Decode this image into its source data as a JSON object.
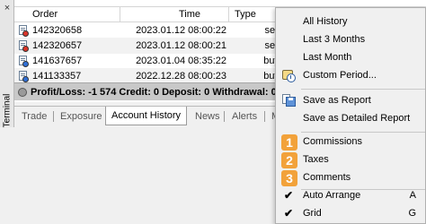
{
  "terminal": {
    "side_label": "Terminal",
    "close_glyph": "×",
    "columns": {
      "order": "Order",
      "time": "Time",
      "type": "Type"
    },
    "rows": [
      {
        "order": "142320658",
        "time": "2023.01.12 08:00:22",
        "type": "sell",
        "icon": "order-sell-icon"
      },
      {
        "order": "142320657",
        "time": "2023.01.12 08:00:21",
        "type": "sell",
        "icon": "order-sell-icon"
      },
      {
        "order": "141637657",
        "time": "2023.01.04 08:35:22",
        "type": "buy",
        "icon": "order-buy-icon"
      },
      {
        "order": "141133357",
        "time": "2022.12.28 08:00:23",
        "type": "buy",
        "icon": "order-buy-icon"
      }
    ],
    "summary": "Profit/Loss: -1 574  Credit: 0  Deposit: 0  Withdrawal: 0",
    "tabs": [
      "Trade",
      "Exposure",
      "Account History",
      "News",
      "Alerts",
      "M"
    ],
    "active_tab": "Account History"
  },
  "context_menu": {
    "items": {
      "all_history": "All History",
      "last_3_months": "Last 3 Months",
      "last_month": "Last Month",
      "custom_period": "Custom Period...",
      "save_report": "Save as Report",
      "save_detailed_report": "Save as Detailed Report",
      "commissions": "Commissions",
      "taxes": "Taxes",
      "comments": "Comments",
      "auto_arrange": "Auto Arrange",
      "grid": "Grid"
    },
    "badges": {
      "b1": "1",
      "b2": "2",
      "b3": "3"
    },
    "shortcuts": {
      "auto_arrange": "A",
      "grid": "G"
    },
    "check_glyph": "✔"
  },
  "colors": {
    "badge": "#f2a23a",
    "sell_icon": "#d9352a",
    "buy_icon": "#2f6fd6"
  }
}
